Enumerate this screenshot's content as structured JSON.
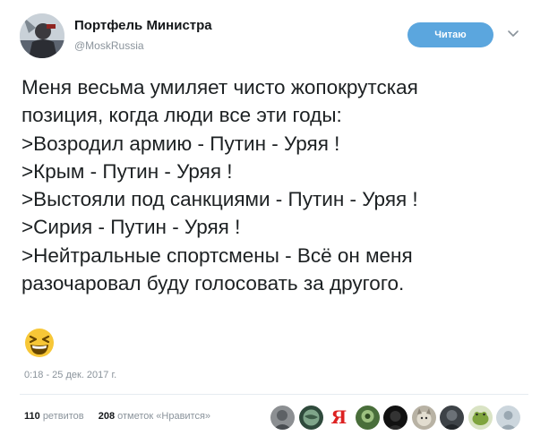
{
  "author": {
    "name": "Портфель Министра",
    "handle": "@MoskRussia"
  },
  "follow_button": {
    "label": "Читаю"
  },
  "tweet": {
    "lines": [
      "Меня весьма умиляет чисто жопокрутская",
      "позиция, когда люди все эти годы:",
      ">Возродил армию - Путин - Уряя !",
      ">Крым - Путин - Уряя !",
      ">Выстояли под санкциями - Путин - Уряя !",
      ">Сирия - Путин - Уряя !",
      ">Нейтральные спортсмены - Всё он меня",
      "разочаровал буду голосовать за другого."
    ],
    "emoji": "grinning-squinting-face-emoji",
    "timestamp": "0:18 - 25 дек. 2017 г."
  },
  "stats": {
    "retweets_count": "110",
    "retweets_label": "ретвитов",
    "likes_count": "208",
    "likes_label": "отметок «Нравится»"
  },
  "likers": [
    {
      "icon": "avatar-gray"
    },
    {
      "icon": "avatar-dark-globe"
    },
    {
      "icon": "avatar-letter",
      "text": "Я"
    },
    {
      "icon": "avatar-green"
    },
    {
      "icon": "avatar-black"
    },
    {
      "icon": "avatar-cat"
    },
    {
      "icon": "avatar-dark"
    },
    {
      "icon": "avatar-frog"
    },
    {
      "icon": "avatar-default"
    }
  ],
  "colors": {
    "accent": "#5ba6de",
    "muted_text": "#8a939b",
    "main_text": "#1c2022"
  }
}
